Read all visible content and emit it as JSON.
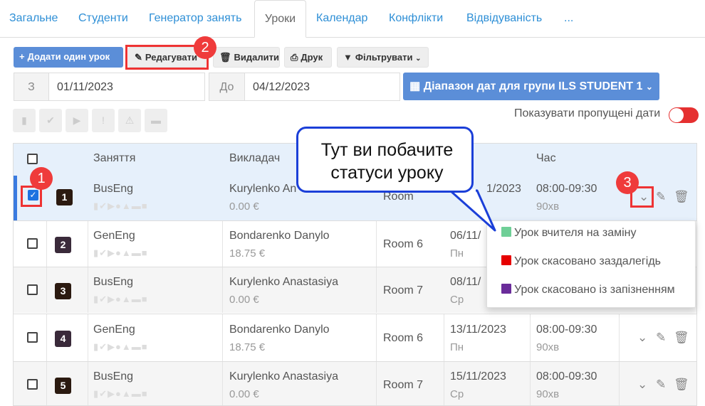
{
  "tabs": [
    {
      "label": "Загальне"
    },
    {
      "label": "Студенти"
    },
    {
      "label": "Генератор занять"
    },
    {
      "label": "Уроки"
    },
    {
      "label": "Календар"
    },
    {
      "label": "Конфлікти"
    },
    {
      "label": "Відвідуваність"
    },
    {
      "label": "..."
    }
  ],
  "active_tab": "Уроки",
  "toolbar": {
    "add_one": "Додати один урок",
    "edit": "Редагувати",
    "delete": "Видалити",
    "print": "Друк",
    "filter": "Фільтрувати"
  },
  "date_range": {
    "from_addon": "З",
    "from_value": "01/11/2023",
    "to_addon": "До",
    "to_value": "04/12/2023",
    "group_button": "Діапазон дат для групи ILS STUDENT 1"
  },
  "show_missed_label": "Показувати пропущені дати",
  "table": {
    "headers": {
      "lesson": "Заняття",
      "teacher": "Викладач",
      "time": "Час"
    },
    "rows": [
      {
        "num": "1",
        "color": "#2b1a10",
        "lesson": "BusEng",
        "teacher": "Kurylenko An",
        "price": "0.00 €",
        "room": "Room",
        "date": "1/2023",
        "day": "",
        "time": "08:00-09:30",
        "duration": "90хв",
        "checked": true
      },
      {
        "num": "2",
        "color": "#3a2a3a",
        "lesson": "GenEng",
        "teacher": "Bondarenko Danylo",
        "price": "18.75 €",
        "room": "Room 6",
        "date": "06/11/",
        "day": "Пн",
        "time": "",
        "duration": "",
        "checked": false
      },
      {
        "num": "3",
        "color": "#2b1a10",
        "lesson": "BusEng",
        "teacher": "Kurylenko Anastasiya",
        "price": "0.00 €",
        "room": "Room 7",
        "date": "08/11/",
        "day": "Ср",
        "time": "",
        "duration": "",
        "checked": false
      },
      {
        "num": "4",
        "color": "#3a2a3a",
        "lesson": "GenEng",
        "teacher": "Bondarenko Danylo",
        "price": "18.75 €",
        "room": "Room 6",
        "date": "13/11/2023",
        "day": "Пн",
        "time": "08:00-09:30",
        "duration": "90хв",
        "checked": false
      },
      {
        "num": "5",
        "color": "#2b1a10",
        "lesson": "BusEng",
        "teacher": "Kurylenko Anastasiya",
        "price": "0.00 €",
        "room": "Room 7",
        "date": "15/11/2023",
        "day": "Ср",
        "time": "08:00-09:30",
        "duration": "90хв",
        "checked": false
      }
    ]
  },
  "status_dropdown": [
    {
      "label": "Урок вчителя на заміну",
      "color": "#6fcf97"
    },
    {
      "label": "Урок скасовано заздалегідь",
      "color": "#e60000"
    },
    {
      "label": "Урок скасовано із запізненням",
      "color": "#6a2c9a"
    }
  ],
  "callout": {
    "line1": "Тут ви побачите",
    "line2": "статуси уроку"
  },
  "badges": {
    "b1": "1",
    "b2": "2",
    "b3": "3"
  },
  "icons": {
    "plus": "plus-icon",
    "pencil": "pencil-icon",
    "trash": "trash-icon",
    "print": "print-icon",
    "filter": "filter-icon",
    "calendar": "calendar-icon",
    "chevron": "chevron-down-icon"
  }
}
